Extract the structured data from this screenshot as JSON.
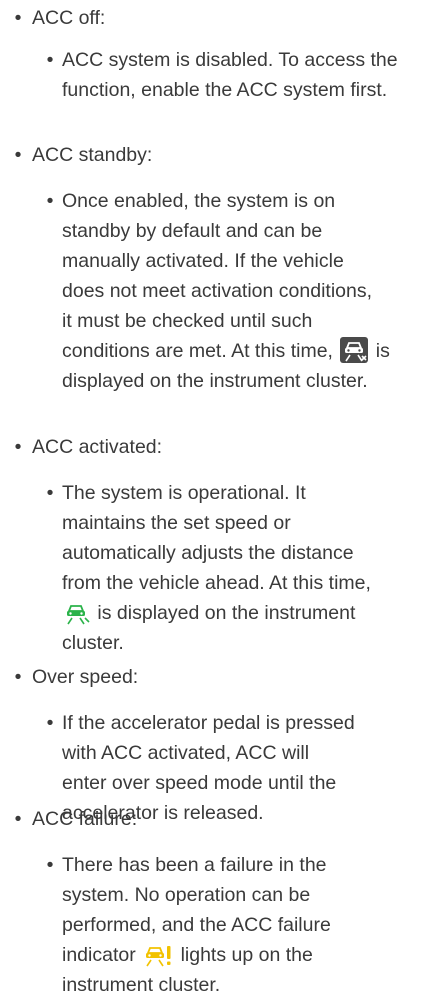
{
  "items": [
    {
      "label": "ACC off:",
      "lines": [
        "ACC system is disabled. To access the",
        "function, enable the ACC system first."
      ]
    },
    {
      "label": "ACC standby:",
      "lines": [
        "Once enabled, the system is on",
        "standby by default and can be",
        "manually activated. If the vehicle",
        "does not meet activation conditions,",
        "it must be checked until such"
      ],
      "icon_line_before": "conditions are met. At this time,",
      "icon_line_after": "is",
      "last_line": "displayed on the instrument cluster."
    },
    {
      "label": "ACC activated:",
      "lines": [
        "The system is operational. It",
        "maintains the set speed or",
        "automatically adjusts the distance",
        "from the vehicle ahead. At this time,"
      ],
      "icon_line_after": "is displayed on the instrument",
      "last_line": "cluster."
    },
    {
      "label": "Over speed:",
      "lines": [
        "If the accelerator pedal is pressed",
        "with ACC activated, ACC will",
        "enter over speed mode until the",
        "accelerator is released."
      ]
    },
    {
      "label": "ACC failure:",
      "lines": [
        "There has been a failure in the",
        "system. No operation can be",
        "performed, and the ACC failure"
      ],
      "icon_line_before": "indicator",
      "icon_line_after": "lights up on the",
      "last_line": "instrument cluster."
    }
  ],
  "bullet_glyph": "•",
  "icons": {
    "standby": {
      "name": "acc-standby-icon",
      "color": "#555555"
    },
    "activated": {
      "name": "acc-activated-icon",
      "color": "#2bb34a"
    },
    "failure": {
      "name": "acc-failure-icon",
      "color": "#f2c200"
    }
  }
}
